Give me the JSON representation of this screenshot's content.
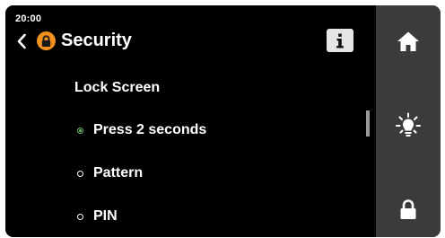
{
  "status_bar": {
    "time": "20:00"
  },
  "header": {
    "back_icon": "chevron-left-icon",
    "badge_icon": "lock-icon",
    "badge_color": "#f0911e",
    "title": "Security",
    "info_label": "i"
  },
  "content": {
    "section_heading": "Lock Screen",
    "options": [
      {
        "label": "Press 2 seconds",
        "selected": true
      },
      {
        "label": "Pattern",
        "selected": false
      },
      {
        "label": "PIN",
        "selected": false
      }
    ],
    "selected_color": "#6cc070"
  },
  "sidebar": {
    "background": "#3b3b3b",
    "items": [
      {
        "name": "home",
        "icon": "home-icon"
      },
      {
        "name": "light",
        "icon": "light-bulb-icon"
      },
      {
        "name": "lock",
        "icon": "lock-icon"
      }
    ]
  }
}
